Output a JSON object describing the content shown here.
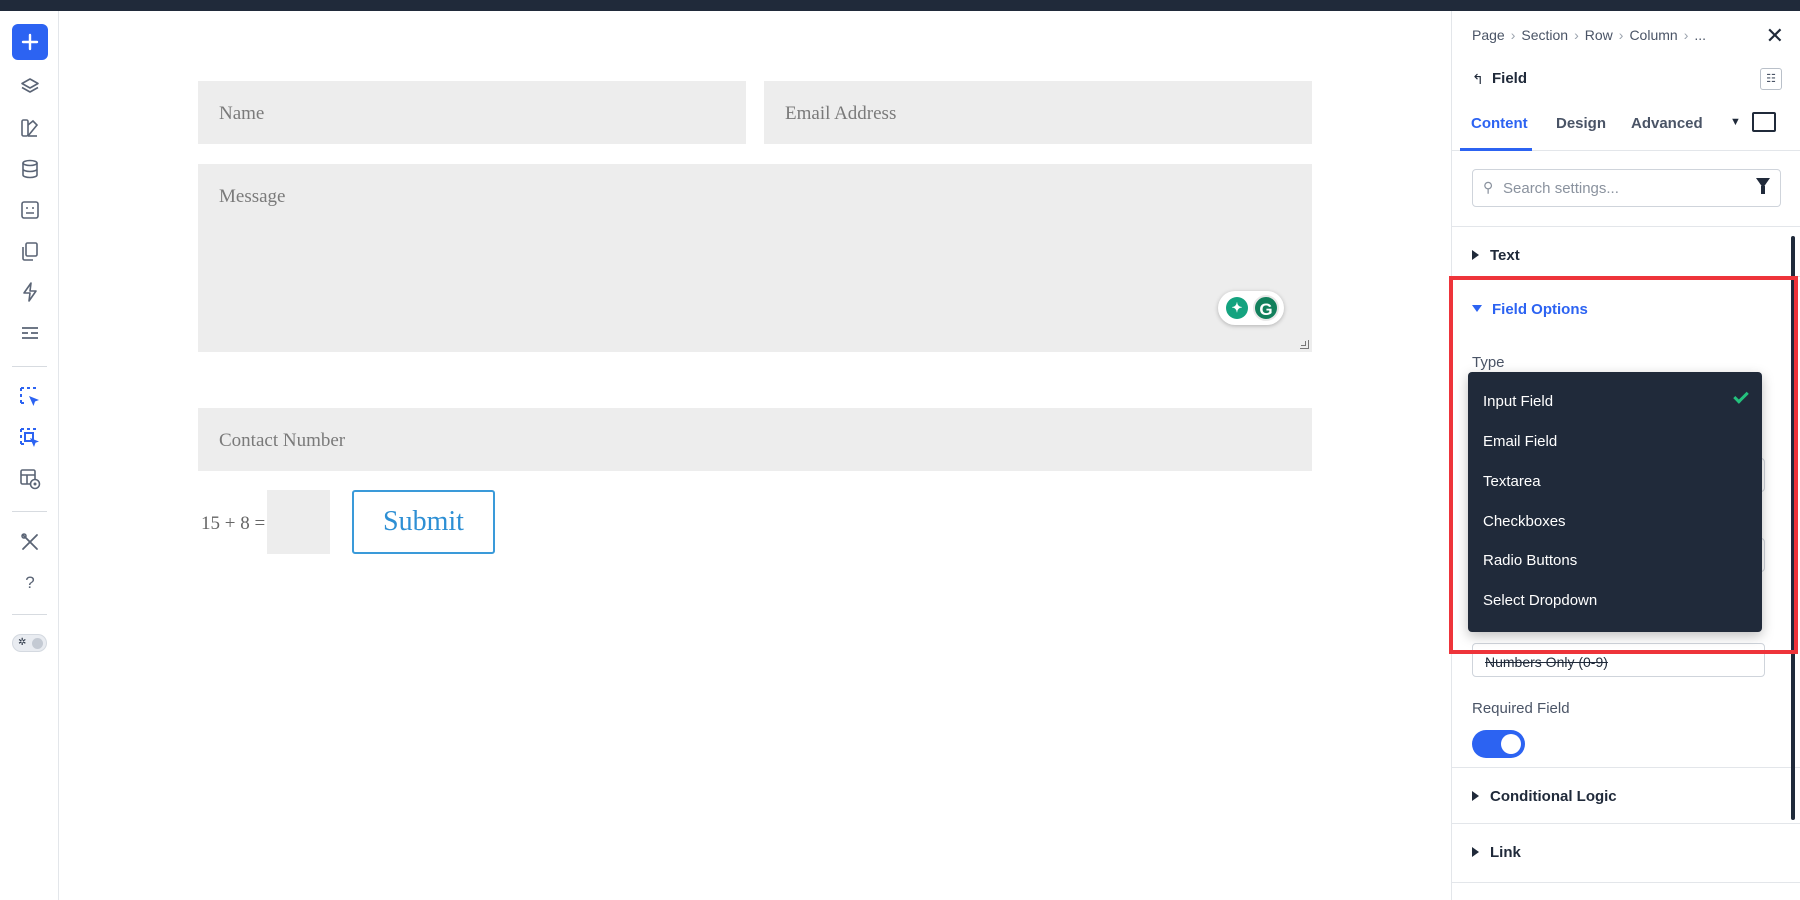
{
  "form": {
    "name_placeholder": "Name",
    "email_placeholder": "Email Address",
    "message_placeholder": "Message",
    "contact_placeholder": "Contact Number",
    "captcha_label": "15 + 8 =",
    "submit_label": "Submit"
  },
  "rail": {
    "icons": [
      "add-icon",
      "layers-icon",
      "brush-icon",
      "database-icon",
      "template-icon",
      "pages-icon",
      "lightning-icon",
      "menu-lines-icon",
      "select-cursor-icon",
      "multi-select-cursor-icon",
      "layout-visibility-icon",
      "tools-icon",
      "help-icon",
      "theme-toggle-icon"
    ],
    "help": "?"
  },
  "panel": {
    "breadcrumbs": [
      "Page",
      "Section",
      "Row",
      "Column",
      "..."
    ],
    "title": "Field",
    "tabs": [
      "Content",
      "Design",
      "Advanced"
    ],
    "search_placeholder": "Search settings...",
    "sections": {
      "text": "Text",
      "field_options": "Field Options",
      "conditional_logic": "Conditional Logic",
      "link": "Link"
    },
    "type_label": "Type",
    "numbers_only": "Numbers Only (0-9)",
    "required_label": "Required Field",
    "required_on": true
  },
  "dropdown": {
    "selected": "Input Field",
    "options": [
      "Input Field",
      "Email Field",
      "Textarea",
      "Checkboxes",
      "Radio Buttons",
      "Select Dropdown"
    ]
  },
  "colors": {
    "accent": "#2c63f2",
    "highlight": "#ee343a",
    "dark": "#202a3a",
    "check": "#24c17d"
  }
}
